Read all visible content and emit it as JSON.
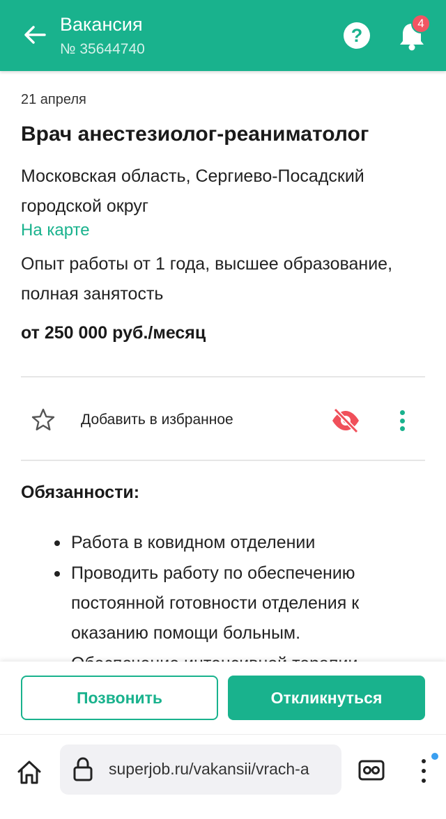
{
  "header": {
    "title": "Вакансия",
    "subtitle": "№ 35644740",
    "notification_count": "4",
    "help_glyph": "?",
    "back_icon": "arrow-left-icon",
    "help_icon": "question-icon",
    "bell_icon": "bell-icon"
  },
  "vacancy": {
    "date": "21 апреля",
    "title": "Врач анестезиолог-реаниматолог",
    "location": "Московская область, Сергиево-Посадский городской округ",
    "map_link": "На карте",
    "requirements": "Опыт работы от 1 года, высшее образование, полная занятость",
    "salary": "от 250 000 руб./месяц"
  },
  "actions": {
    "favorite_label": "Добавить в избранное",
    "favorite_icon": "star-outline-icon",
    "hide_icon": "eye-off-icon",
    "more_icon": "more-vertical-icon"
  },
  "duties": {
    "title": "Обязанности:",
    "items": [
      "Работа в ковидном отделении",
      "Проводить работу по обеспечению постоянной готовности отделения к оказанию помощи больным.",
      "Обеспечение интенсивной терапии"
    ]
  },
  "buttons": {
    "call": "Позвонить",
    "apply": "Откликнуться"
  },
  "browser": {
    "url": "superjob.ru/vakansii/vrach-a",
    "home_icon": "home-icon",
    "lock_icon": "lock-icon",
    "reader_icon": "reader-mode-icon",
    "menu_icon": "more-vertical-icon"
  },
  "colors": {
    "brand": "#19b28d",
    "badge": "#f25563",
    "hide_icon": "#f0505a",
    "browser_dot": "#3a9ff0"
  }
}
